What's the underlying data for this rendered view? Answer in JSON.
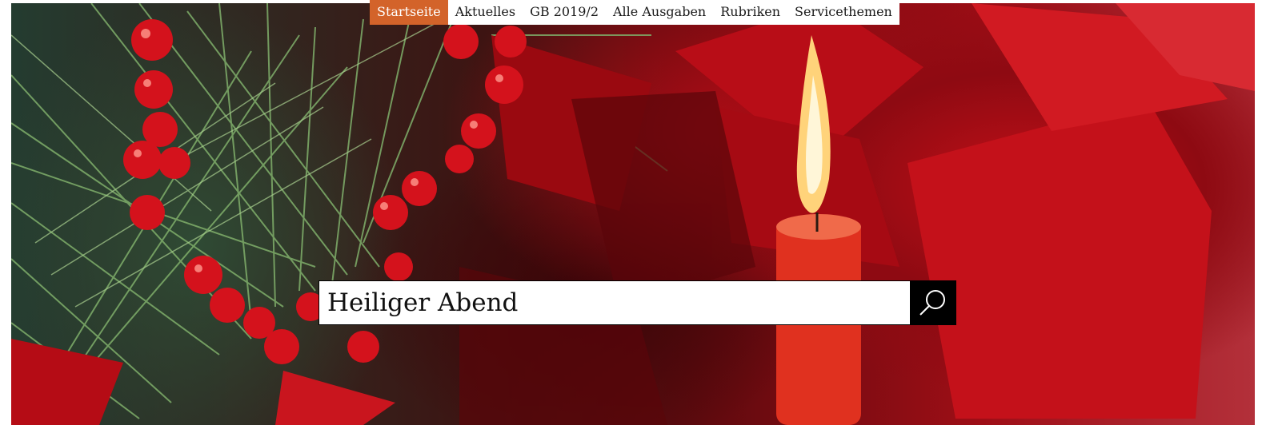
{
  "nav": {
    "items": [
      {
        "label": "Startseite",
        "active": true
      },
      {
        "label": "Aktuelles",
        "active": false
      },
      {
        "label": "GB 2019/2",
        "active": false
      },
      {
        "label": "Alle Ausgaben",
        "active": false
      },
      {
        "label": "Rubriken",
        "active": false
      },
      {
        "label": "Servicethemen",
        "active": false
      }
    ]
  },
  "search": {
    "value": "Heiliger Abend",
    "button_icon": "search-icon"
  },
  "hero": {
    "image": "christmas-candle-poinsettia-image"
  },
  "colors": {
    "accent": "#d3632a",
    "search_button": "#000000"
  }
}
